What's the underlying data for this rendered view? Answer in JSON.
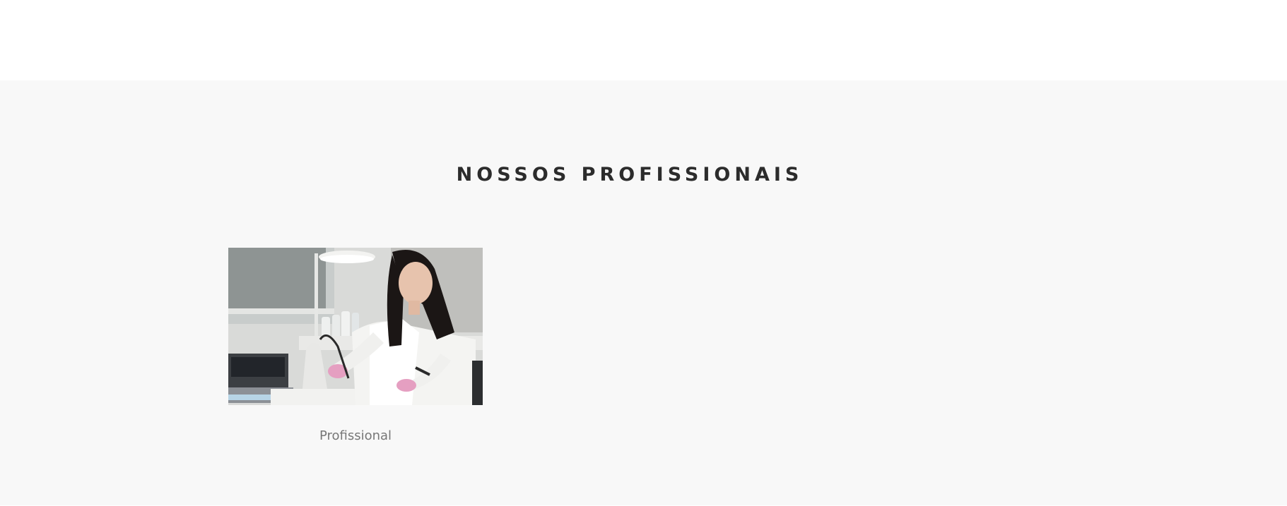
{
  "section": {
    "title": "NOSSOS PROFISSIONAIS",
    "background": "#f8f8f8"
  },
  "professionals": [
    {
      "caption": "Profissional",
      "photo_description": "esthetician-treating-client-photo"
    }
  ]
}
